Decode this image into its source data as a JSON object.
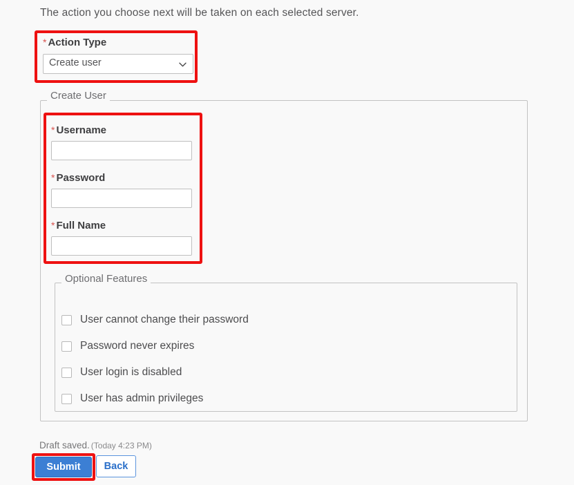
{
  "intro": {
    "text": "The action you choose next will be taken on each selected server."
  },
  "action_type": {
    "label": "Action Type",
    "required_marker": "*",
    "selected_value": "Create user",
    "chevron_icon": "chevron-down-icon",
    "highlighted": true,
    "highlight_color": "#ee1111"
  },
  "create_user_fieldset": {
    "legend": "Create User",
    "fields": [
      {
        "label": "Username",
        "required_marker": "*",
        "value": "",
        "placeholder": ""
      },
      {
        "label": "Password",
        "required_marker": "*",
        "value": "",
        "placeholder": ""
      },
      {
        "label": "Full Name",
        "required_marker": "*",
        "value": "",
        "placeholder": ""
      }
    ],
    "fields_highlighted": true
  },
  "optional_features": {
    "legend": "Optional Features",
    "checkboxes": [
      {
        "label": "User cannot change their password",
        "checked": false
      },
      {
        "label": "Password never expires",
        "checked": false
      },
      {
        "label": "User login is disabled",
        "checked": false
      },
      {
        "label": "User has admin privileges",
        "checked": false
      }
    ]
  },
  "footer": {
    "draft_status": "Draft saved.",
    "draft_timestamp": "(Today 4:23 PM)",
    "submit_label": "Submit",
    "back_label": "Back",
    "submit_highlighted": true,
    "submit_color": "#3c7fd4",
    "back_text_color": "#2a6fc9"
  }
}
